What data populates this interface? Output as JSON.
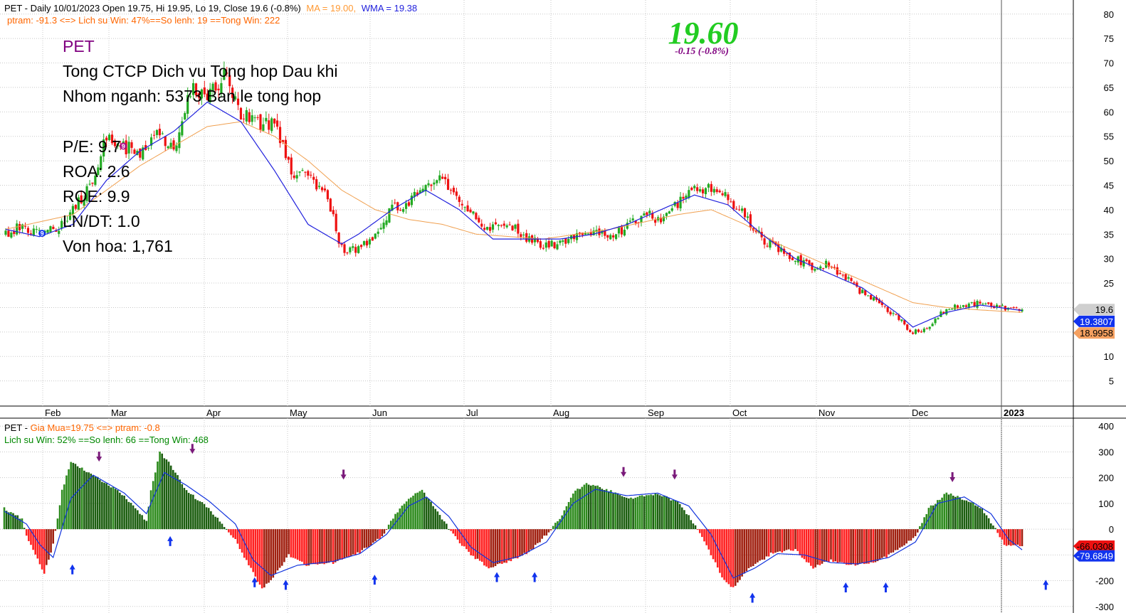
{
  "price_panel": {
    "header_line1": "PET - Daily 10/01/2023 Open 19.75, Hi 19.95, Lo 19, Close 19.6 (-0.8%)",
    "ma_label": "MA = 19.00,",
    "wma_label": "WMA = 19.38",
    "header_line2": "ptram: -91.3 <=> Lich su Win: 47%==So lenh: 19 ==Tong Win: 222",
    "big_price": "19.60",
    "change_text": "-0.15  (-0.8%)",
    "info_lines": [
      "PET",
      "Tong CTCP Dich vu Tong hop Dau khi",
      "Nhom nganh: 5373 Ban le tong hop",
      "",
      "P/E: 9.7",
      "ROA: 2.6",
      "ROE: 9.9",
      "LN/DT: 1.0",
      "Von hoa: 1,761"
    ],
    "price_tag": "19.6",
    "wma_tag": "19.3807",
    "ma_tag": "18.9958"
  },
  "osc_panel": {
    "header_line1_prefix": "PET - ",
    "header_line1": "Gia Mua=19.75 <=> ptram: -0.8",
    "header_line2": "Lich su Win: 52% ==So lenh: 66 ==Tong Win: 468",
    "tag_value": "-66.0308",
    "tag_signal": "-79.6849"
  },
  "colors": {
    "up": "#22aa22",
    "down": "#ee1111",
    "wma": "#2222dd",
    "ma": "#f0a050",
    "osc_pos_light": "#2e8b1e",
    "osc_pos_dark": "#1c5e10",
    "osc_neg_light": "#ff2020",
    "osc_neg_dark": "#a02010",
    "big_price": "#22cc22",
    "change": "#800080",
    "header_orange": "#ff6600",
    "header_green": "#008800"
  },
  "chart_data": [
    {
      "type": "candlestick",
      "ylim": [
        0,
        82
      ],
      "y_ticks": [
        5,
        10,
        15,
        20,
        25,
        30,
        35,
        40,
        45,
        50,
        55,
        60,
        65,
        70,
        75,
        80
      ],
      "x_labels": [
        "Feb",
        "Mar",
        "Apr",
        "May",
        "Jun",
        "Jul",
        "Aug",
        "Sep",
        "Oct",
        "Nov",
        "Dec",
        "2023"
      ],
      "series_anchors": {
        "close": [
          [
            0,
            35
          ],
          [
            6,
            37
          ],
          [
            12,
            35
          ],
          [
            18,
            36
          ],
          [
            24,
            40
          ],
          [
            30,
            45
          ],
          [
            36,
            55
          ],
          [
            42,
            53
          ],
          [
            48,
            52
          ],
          [
            54,
            56
          ],
          [
            60,
            52
          ],
          [
            66,
            65
          ],
          [
            72,
            63
          ],
          [
            78,
            68
          ],
          [
            84,
            60
          ],
          [
            90,
            58
          ],
          [
            96,
            58
          ],
          [
            102,
            47
          ],
          [
            108,
            47
          ],
          [
            114,
            44
          ],
          [
            120,
            32
          ],
          [
            126,
            32
          ],
          [
            132,
            35
          ],
          [
            138,
            40
          ],
          [
            144,
            42
          ],
          [
            150,
            44
          ],
          [
            156,
            46
          ],
          [
            162,
            42
          ],
          [
            168,
            38
          ],
          [
            174,
            36
          ],
          [
            180,
            37
          ],
          [
            186,
            34
          ],
          [
            192,
            33
          ],
          [
            198,
            33
          ],
          [
            204,
            35
          ],
          [
            210,
            36
          ],
          [
            216,
            34
          ],
          [
            222,
            37
          ],
          [
            228,
            39
          ],
          [
            234,
            38
          ],
          [
            240,
            41
          ],
          [
            246,
            44
          ],
          [
            252,
            44
          ],
          [
            258,
            42
          ],
          [
            264,
            39
          ],
          [
            270,
            34
          ],
          [
            276,
            32
          ],
          [
            282,
            30
          ],
          [
            288,
            28
          ],
          [
            294,
            29
          ],
          [
            300,
            26
          ],
          [
            306,
            23
          ],
          [
            312,
            21
          ],
          [
            318,
            18
          ],
          [
            324,
            15
          ],
          [
            330,
            16
          ],
          [
            336,
            20
          ],
          [
            342,
            20
          ],
          [
            348,
            21
          ],
          [
            354,
            20
          ],
          [
            360,
            19.5
          ],
          [
            363,
            19.6
          ]
        ],
        "wma": [
          [
            0,
            36
          ],
          [
            12,
            34.5
          ],
          [
            24,
            37
          ],
          [
            36,
            46
          ],
          [
            48,
            52
          ],
          [
            60,
            56
          ],
          [
            72,
            62
          ],
          [
            84,
            58
          ],
          [
            96,
            48
          ],
          [
            108,
            37
          ],
          [
            120,
            33
          ],
          [
            126,
            35
          ],
          [
            138,
            40
          ],
          [
            150,
            44
          ],
          [
            162,
            40
          ],
          [
            174,
            34
          ],
          [
            186,
            34
          ],
          [
            198,
            34
          ],
          [
            210,
            35
          ],
          [
            222,
            37
          ],
          [
            234,
            40
          ],
          [
            246,
            43
          ],
          [
            258,
            41
          ],
          [
            270,
            35
          ],
          [
            282,
            30
          ],
          [
            294,
            27
          ],
          [
            306,
            24
          ],
          [
            318,
            19
          ],
          [
            324,
            16
          ],
          [
            336,
            19
          ],
          [
            348,
            20.5
          ],
          [
            363,
            19.4
          ]
        ],
        "ma": [
          [
            0,
            36
          ],
          [
            24,
            39
          ],
          [
            48,
            49
          ],
          [
            72,
            57
          ],
          [
            84,
            58
          ],
          [
            96,
            55
          ],
          [
            108,
            50
          ],
          [
            120,
            44
          ],
          [
            132,
            40
          ],
          [
            144,
            38
          ],
          [
            156,
            37
          ],
          [
            168,
            35
          ],
          [
            180,
            34.5
          ],
          [
            192,
            34
          ],
          [
            204,
            35
          ],
          [
            216,
            36
          ],
          [
            228,
            37.5
          ],
          [
            240,
            39
          ],
          [
            252,
            40
          ],
          [
            264,
            37
          ],
          [
            276,
            33
          ],
          [
            288,
            30
          ],
          [
            300,
            27
          ],
          [
            312,
            24
          ],
          [
            324,
            21
          ],
          [
            336,
            20
          ],
          [
            348,
            19.5
          ],
          [
            363,
            19.0
          ]
        ]
      },
      "markers": [
        {
          "label": "9",
          "color": "blue",
          "x_index": 13
        },
        {
          "label": "9",
          "color": "purple",
          "x_index": 42
        }
      ],
      "last_price": 19.6,
      "wma_last": 19.3807,
      "ma_last": 18.9958
    },
    {
      "type": "bar",
      "ylim": [
        -320,
        420
      ],
      "y_ticks": [
        -300,
        -200,
        -100,
        0,
        100,
        200,
        300,
        400
      ],
      "histogram_anchors": [
        [
          0,
          80
        ],
        [
          8,
          40
        ],
        [
          10,
          -30
        ],
        [
          14,
          -100
        ],
        [
          18,
          -170
        ],
        [
          22,
          -60
        ],
        [
          26,
          150
        ],
        [
          30,
          260
        ],
        [
          34,
          240
        ],
        [
          42,
          200
        ],
        [
          54,
          130
        ],
        [
          64,
          30
        ],
        [
          66,
          150
        ],
        [
          70,
          300
        ],
        [
          74,
          260
        ],
        [
          82,
          150
        ],
        [
          92,
          80
        ],
        [
          104,
          -40
        ],
        [
          110,
          -140
        ],
        [
          116,
          -230
        ],
        [
          120,
          -200
        ],
        [
          128,
          -100
        ],
        [
          136,
          -140
        ],
        [
          148,
          -130
        ],
        [
          160,
          -90
        ],
        [
          170,
          -30
        ],
        [
          176,
          60
        ],
        [
          182,
          120
        ],
        [
          188,
          150
        ],
        [
          194,
          80
        ],
        [
          202,
          -20
        ],
        [
          210,
          -100
        ],
        [
          218,
          -150
        ],
        [
          228,
          -120
        ],
        [
          236,
          -90
        ],
        [
          244,
          -20
        ],
        [
          250,
          40
        ],
        [
          256,
          140
        ],
        [
          262,
          180
        ],
        [
          272,
          150
        ],
        [
          282,
          120
        ],
        [
          294,
          140
        ],
        [
          304,
          100
        ],
        [
          312,
          0
        ],
        [
          318,
          -100
        ],
        [
          324,
          -200
        ],
        [
          328,
          -230
        ],
        [
          334,
          -160
        ],
        [
          346,
          -90
        ],
        [
          356,
          -80
        ],
        [
          364,
          -150
        ],
        [
          372,
          -120
        ],
        [
          380,
          -140
        ],
        [
          392,
          -130
        ],
        [
          402,
          -80
        ],
        [
          410,
          -30
        ],
        [
          416,
          80
        ],
        [
          424,
          140
        ],
        [
          434,
          110
        ],
        [
          440,
          80
        ],
        [
          446,
          0
        ],
        [
          450,
          -60
        ],
        [
          458,
          -66
        ]
      ],
      "signal_anchors": [
        [
          0,
          70
        ],
        [
          10,
          20
        ],
        [
          16,
          -60
        ],
        [
          22,
          -110
        ],
        [
          30,
          120
        ],
        [
          40,
          210
        ],
        [
          54,
          140
        ],
        [
          64,
          60
        ],
        [
          72,
          220
        ],
        [
          82,
          170
        ],
        [
          92,
          110
        ],
        [
          104,
          20
        ],
        [
          112,
          -120
        ],
        [
          120,
          -180
        ],
        [
          132,
          -140
        ],
        [
          148,
          -125
        ],
        [
          160,
          -95
        ],
        [
          172,
          -20
        ],
        [
          182,
          90
        ],
        [
          190,
          125
        ],
        [
          200,
          50
        ],
        [
          210,
          -70
        ],
        [
          220,
          -130
        ],
        [
          232,
          -105
        ],
        [
          244,
          -50
        ],
        [
          256,
          100
        ],
        [
          266,
          155
        ],
        [
          280,
          130
        ],
        [
          294,
          140
        ],
        [
          308,
          90
        ],
        [
          318,
          -20
        ],
        [
          328,
          -190
        ],
        [
          338,
          -150
        ],
        [
          348,
          -95
        ],
        [
          360,
          -100
        ],
        [
          372,
          -130
        ],
        [
          384,
          -135
        ],
        [
          398,
          -110
        ],
        [
          410,
          -50
        ],
        [
          420,
          100
        ],
        [
          432,
          125
        ],
        [
          444,
          60
        ],
        [
          452,
          -40
        ],
        [
          458,
          -80
        ]
      ],
      "last_value": -66.0308,
      "signal_last": -79.6849
    }
  ]
}
